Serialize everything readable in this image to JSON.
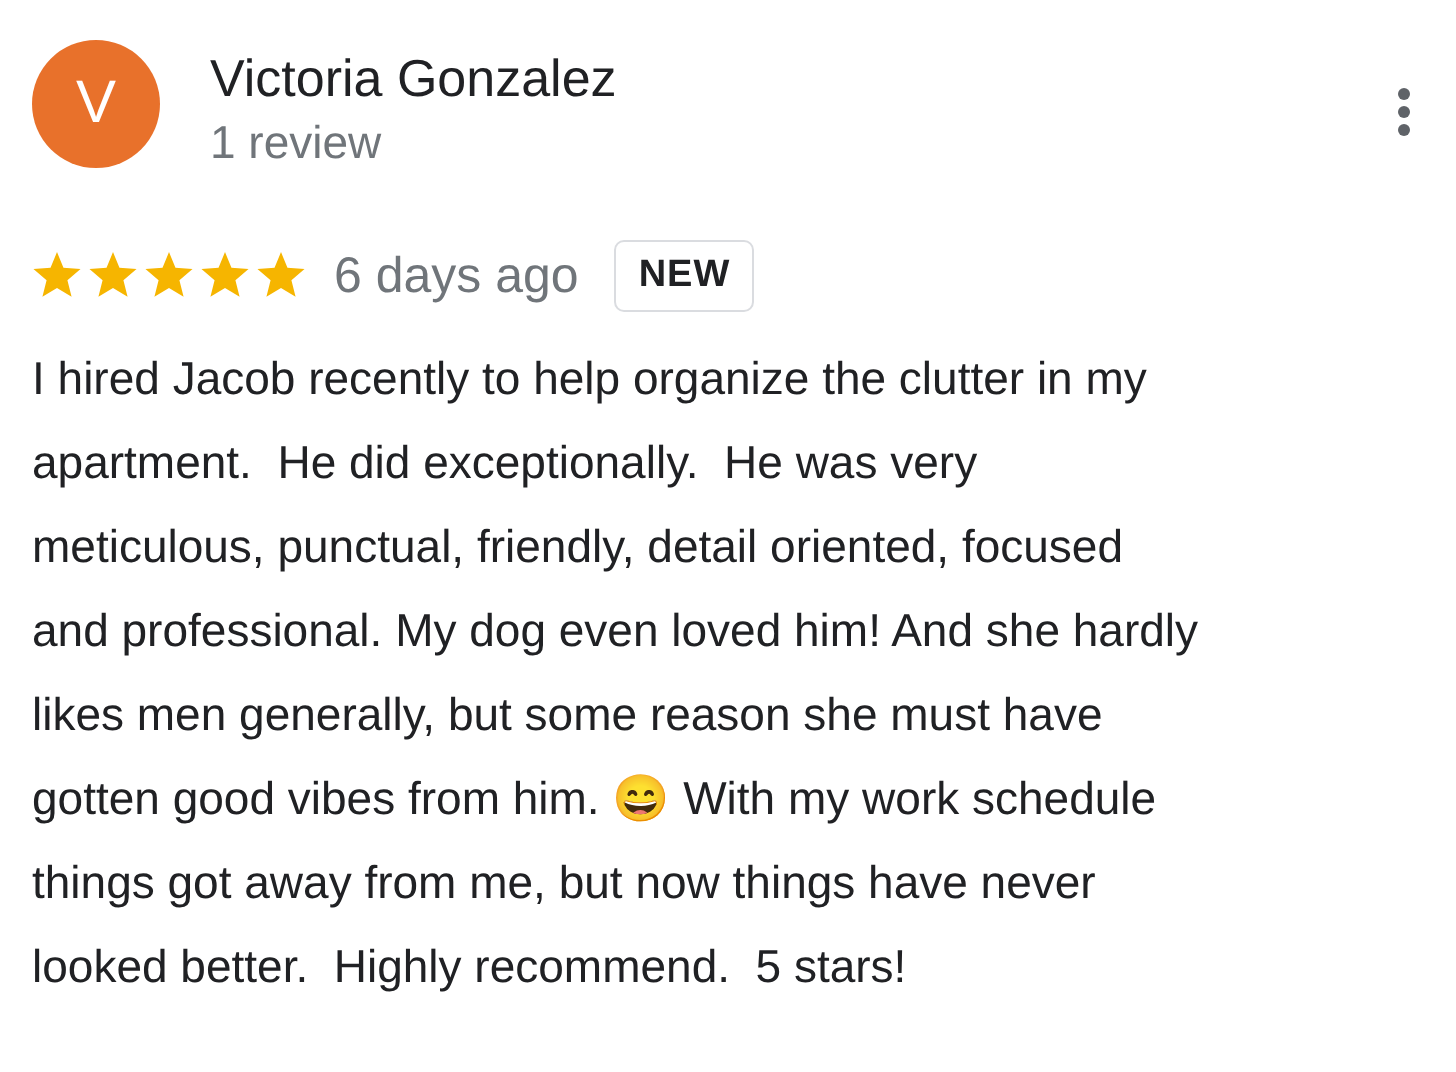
{
  "reviewer": {
    "initial": "V",
    "name": "Victoria Gonzalez",
    "review_count": "1 review"
  },
  "review": {
    "stars": 5,
    "time": "6 days ago",
    "badge": "NEW",
    "text": "I hired Jacob recently to help organize the clutter in my\napartment.  He did exceptionally.  He was very\nmeticulous, punctual, friendly, detail oriented, focused\nand professional. My dog even loved him! And she hardly\nlikes men generally, but some reason she must have\ngotten good vibes from him. 😄 With my work schedule\nthings got away from me, but now things have never\nlooked better.  Highly recommend.  5 stars!"
  }
}
